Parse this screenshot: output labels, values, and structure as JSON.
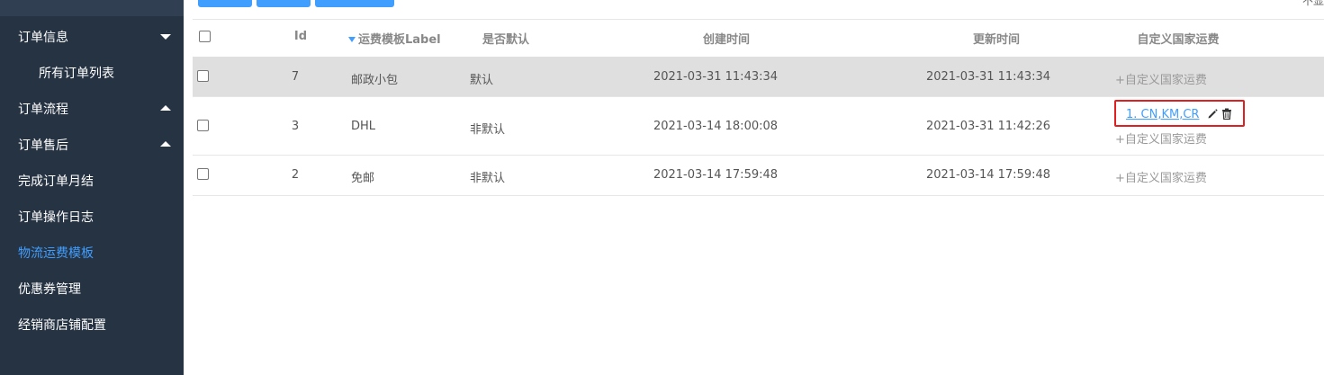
{
  "sidebar": {
    "items": [
      {
        "label": "订单信息",
        "arrow": "down"
      },
      {
        "label": "所有订单列表"
      },
      {
        "label": "订单流程",
        "arrow": "up"
      },
      {
        "label": "订单售后",
        "arrow": "up"
      },
      {
        "label": "完成订单月结"
      },
      {
        "label": "订单操作日志"
      },
      {
        "label": "物流运费模板",
        "active": true
      },
      {
        "label": "优惠券管理"
      },
      {
        "label": "经销商店铺配置"
      }
    ]
  },
  "toolbar": {
    "corner_text": "不显"
  },
  "table": {
    "headers": {
      "id": "Id",
      "label": "运费模板Label",
      "default": "是否默认",
      "created": "创建时间",
      "updated": "更新时间",
      "custom": "自定义国家运费"
    },
    "rows": [
      {
        "id": "7",
        "label": "邮政小包",
        "default": "默认",
        "created": "2021-03-31 11:43:34",
        "updated": "2021-03-31 11:43:34",
        "add": "+自定义国家运费"
      },
      {
        "id": "3",
        "label": "DHL",
        "default": "非默认",
        "created": "2021-03-14 18:00:08",
        "updated": "2021-03-31 11:42:26",
        "countries": "1. CN,KM,CR",
        "add": "+自定义国家运费"
      },
      {
        "id": "2",
        "label": "免邮",
        "default": "非默认",
        "created": "2021-03-14 17:59:48",
        "updated": "2021-03-14 17:59:48",
        "add": "+自定义国家运费"
      }
    ]
  },
  "colors": {
    "sidebar_bg": "#263343",
    "accent": "#409eff",
    "highlight_row": "#dfdfdf",
    "annotation_box": "#e02020"
  }
}
